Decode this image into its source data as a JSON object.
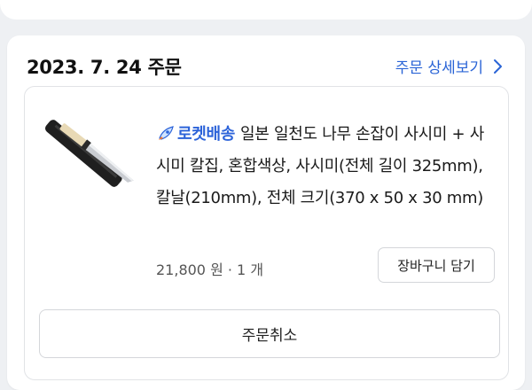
{
  "order": {
    "date": "2023. 7. 24 주문",
    "detail_link": "주문 상세보기"
  },
  "item": {
    "rocket_label": "로켓배송",
    "name": "일본 일천도 나무 손잡이 사시미 + 사시미 칼집, 혼합색상, 사시미(전체 길이 325mm), 칼날(210mm), 전체 크기(370 x 50 x 30 mm)",
    "price_qty": "21,800 원 · 1 개",
    "add_to_cart": "장바구니 담기"
  },
  "actions": {
    "cancel_order": "주문취소"
  },
  "colors": {
    "accent": "#2a64d6",
    "rocket": "#2c63d9",
    "background": "#eef0f3"
  },
  "icons": {
    "rocket": "rocket-icon",
    "chevron": "chevron-right-icon"
  }
}
